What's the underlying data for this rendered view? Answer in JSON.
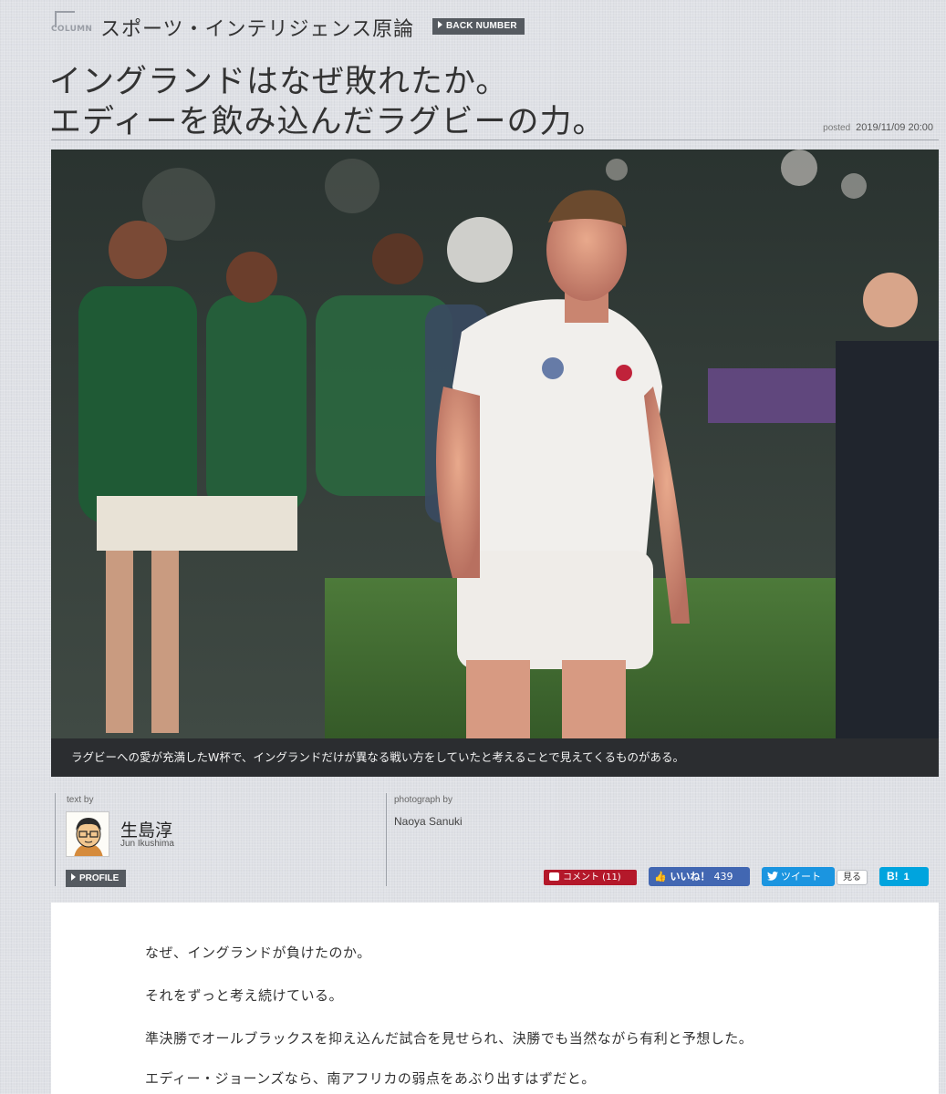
{
  "header": {
    "column_label": "COLUMN",
    "series_title": "スポーツ・インテリジェンス原論",
    "back_number_label": "BACK NUMBER"
  },
  "article": {
    "headline_line1": "イングランドはなぜ敗れたか。",
    "headline_line2": "エディーを飲み込んだラグビーの力。",
    "posted_label": "posted",
    "posted_datetime": "2019/11/09 20:00",
    "photo_caption": "ラグビーへの愛が充満したW杯で、イングランドだけが異なる戦い方をしていたと考えることで見えてくるものがある。"
  },
  "byline": {
    "text_by_label": "text by",
    "author_name": "生島淳",
    "author_roman": "Jun Ikushima",
    "profile_label": "PROFILE",
    "photograph_by_label": "photograph by",
    "photographer": "Naoya Sanuki"
  },
  "social": {
    "comment_label": "コメント (11)",
    "like_label": "いいね！",
    "like_count": "439",
    "tweet_label": "ツイート",
    "see_label": "見る",
    "hatena_label": "B!",
    "hatena_count": "1"
  },
  "body": {
    "paragraphs": [
      "なぜ、イングランドが負けたのか。",
      "それをずっと考え続けている。",
      "準決勝でオールブラックスを抑え込んだ試合を見せられ、決勝でも当然ながら有利と予想した。",
      "エディー・ジョーンズなら、南アフリカの弱点をあぶり出すはずだと。"
    ]
  },
  "colors": {
    "background": "#dfe1e6",
    "caption_bar": "#2b2d30",
    "comment_red": "#b4182a",
    "facebook_blue": "#4267b2",
    "twitter_blue": "#1b95e0",
    "hatena_blue": "#00a4de"
  },
  "icons": [
    "column-icon",
    "play-triangle-icon",
    "comment-icon",
    "thumbs-up-icon",
    "twitter-bird-icon",
    "hatena-icon"
  ]
}
